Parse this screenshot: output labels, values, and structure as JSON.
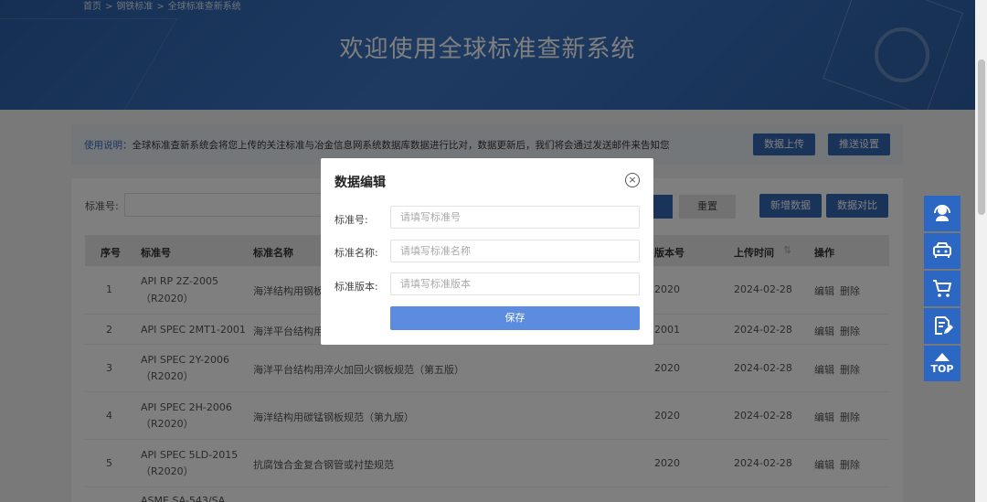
{
  "breadcrumb": [
    "首页",
    ">",
    "钢铁标准",
    ">",
    "全球标准查新系统"
  ],
  "banner_title": "欢迎使用全球标准查新系统",
  "instructions": {
    "label": "使用说明：",
    "text": "全球标准查新系统会将您上传的关注标准与冶金信息网系统数据库数据进行比对，数据更新后，我们将会通过发送邮件来告知您",
    "upload_button": "数据上传",
    "push_button": "推送设置"
  },
  "search": {
    "label": "标准号:",
    "reset_button": "重置",
    "add_button": "新增数据",
    "compare_button": "数据对比"
  },
  "table": {
    "headers": [
      "序号",
      "标准号",
      "标准名称",
      "版本号",
      "上传时间",
      "操作"
    ],
    "rows": [
      {
        "index": "1",
        "code1": "API RP 2Z-2005",
        "code2": "（R2020）",
        "name": "海洋结构用钢板",
        "version": "2020",
        "date": "2024-02-28",
        "edit": "编辑",
        "delete": "删除"
      },
      {
        "index": "2",
        "code1": "API SPEC 2MT1-2001",
        "code2": "",
        "name": "海洋平台结构用",
        "version": "2001",
        "date": "2024-02-28",
        "edit": "编辑",
        "delete": "删除"
      },
      {
        "index": "3",
        "code1": "API SPEC 2Y-2006",
        "code2": "（R2020）",
        "name": "海洋平台结构用淬火加回火钢板规范（第五版）",
        "version": "2020",
        "date": "2024-02-28",
        "edit": "编辑",
        "delete": "删除"
      },
      {
        "index": "4",
        "code1": "API SPEC 2H-2006",
        "code2": "（R2020）",
        "name": "海洋结构用碳锰钢板规范（第九版）",
        "version": "2020",
        "date": "2024-02-28",
        "edit": "编辑",
        "delete": "删除"
      },
      {
        "index": "5",
        "code1": "API SPEC 5LD-2015",
        "code2": "（R2020）",
        "name": "抗腐蚀合金复合钢管或衬垫规范",
        "version": "2020",
        "date": "2024-02-28",
        "edit": "编辑",
        "delete": "删除"
      },
      {
        "index": "",
        "code1": "ASME SA-543/SA",
        "code2": "",
        "name": "",
        "version": "",
        "date": "",
        "edit": "",
        "delete": ""
      }
    ]
  },
  "modal": {
    "title": "数据编辑",
    "fields": [
      {
        "label": "标准号:",
        "placeholder": "请填写标准号"
      },
      {
        "label": "标准名称:",
        "placeholder": "请填写标准名称"
      },
      {
        "label": "标准版本:",
        "placeholder": "请填写标准版本"
      }
    ],
    "save_button": "保存"
  },
  "toolbar": {
    "icons": [
      "customer-service-icon",
      "car-icon",
      "cart-icon",
      "edit-document-icon",
      "back-to-top-icon"
    ],
    "top_label": "TOP"
  },
  "colors": {
    "primary": "#3566b3",
    "save": "#5b8ce0",
    "toolbar": "#2c67c4"
  }
}
